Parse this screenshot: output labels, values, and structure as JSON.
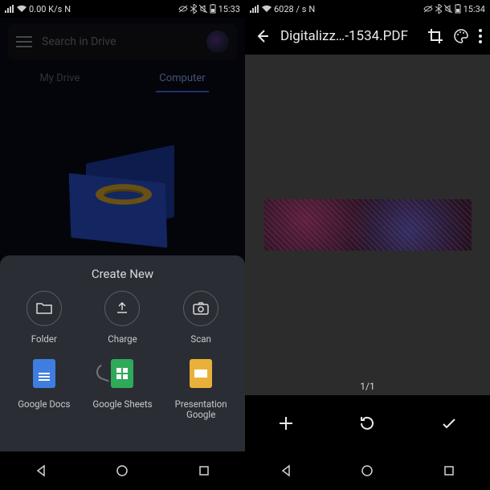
{
  "left": {
    "status": {
      "net": "0.00 K/s",
      "carrier": "N",
      "time": "15:33"
    },
    "search_placeholder": "Search in Drive",
    "tabs": {
      "my_drive": "My Drive",
      "computer": "Computer"
    },
    "sheet": {
      "title": "Create New",
      "folder": "Folder",
      "upload": "Charge",
      "scan": "Scan",
      "docs": "Google Docs",
      "sheets": "Google Sheets",
      "slides": "Presentation\nGoogle"
    }
  },
  "right": {
    "status": {
      "net": "6028 / s",
      "carrier": "N",
      "time": "15:34"
    },
    "title": "Digitalizz…-1534.PDF",
    "page": "1/1"
  }
}
